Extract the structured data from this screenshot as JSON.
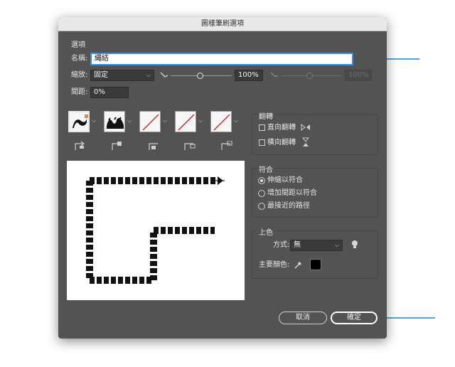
{
  "dialog": {
    "title": "圖樣筆刷選項"
  },
  "options": {
    "section_label": "選項",
    "name_label": "名稱:",
    "name_value": "繩結",
    "scale_label": "縮放:",
    "scale_mode": "固定",
    "scale_value": "100%",
    "scale_value_disabled": "100%",
    "spacing_label": "間距:",
    "spacing_value": "0%"
  },
  "tiles": [
    {
      "name": "side-tile",
      "state": "rope-side"
    },
    {
      "name": "outer-corner-tile",
      "state": "rope-corner"
    },
    {
      "name": "inner-corner-tile",
      "state": "none"
    },
    {
      "name": "start-tile",
      "state": "none"
    },
    {
      "name": "end-tile",
      "state": "none"
    }
  ],
  "flip": {
    "title": "翻轉",
    "flip_along_label": "直向翻轉",
    "flip_across_label": "橫向翻轉",
    "flip_along_checked": false,
    "flip_across_checked": false
  },
  "fit": {
    "title": "符合",
    "options": [
      "伸縮以符合",
      "增加間距以符合",
      "最接近的路徑"
    ],
    "selected_index": 0
  },
  "colorization": {
    "title": "上色",
    "method_label": "方式:",
    "method_value": "無",
    "key_color_label": "主要顏色:",
    "key_color": "#000000"
  },
  "buttons": {
    "cancel": "取消",
    "ok": "確定"
  },
  "colors": {
    "annotation_arrow": "#1a86c8",
    "dialog_bg": "#535353",
    "focus_ring": "#3b8fd9"
  }
}
